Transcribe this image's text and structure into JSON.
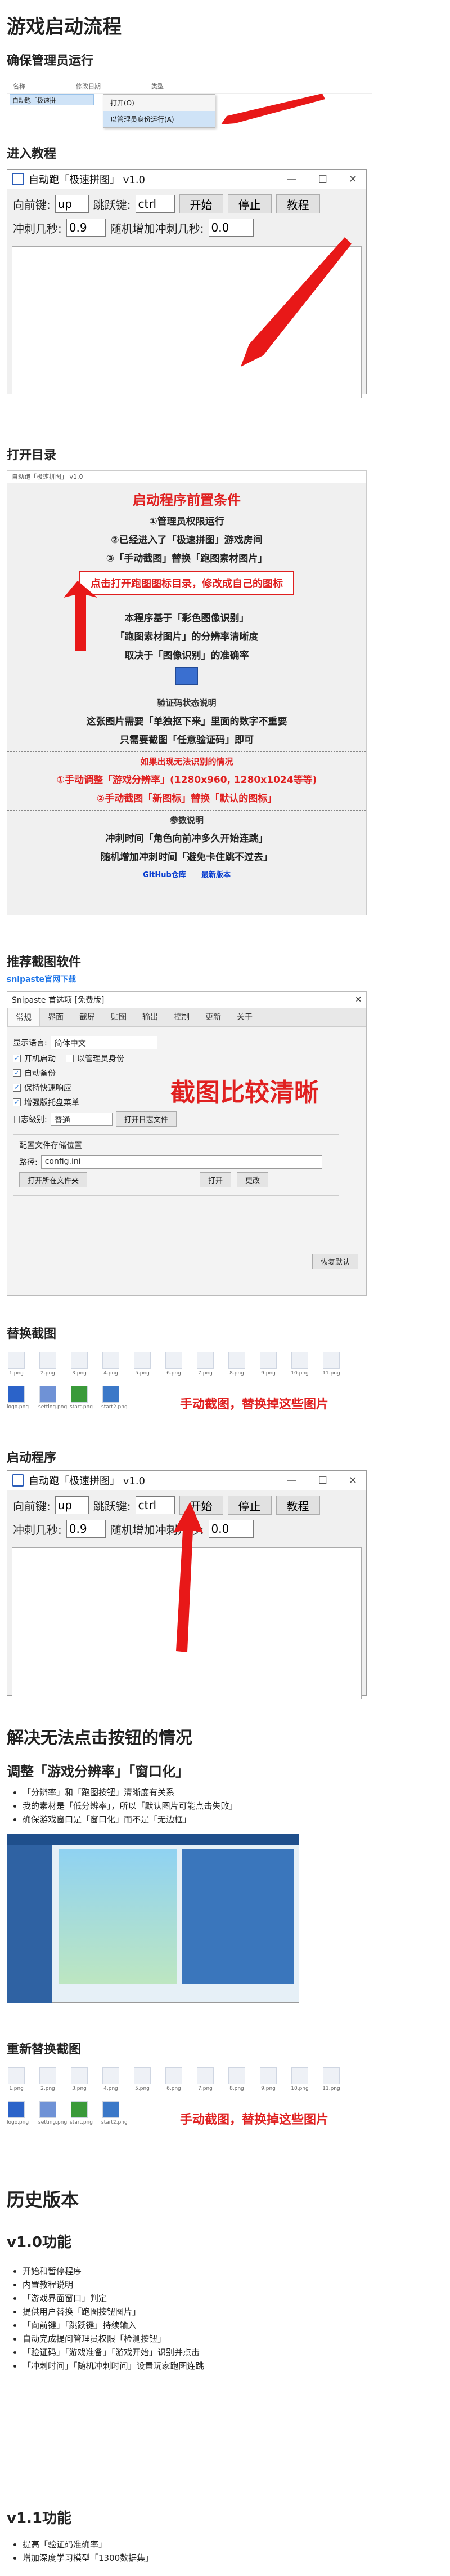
{
  "h_start_flow": "游戏启动流程",
  "h_admin": "确保管理员运行",
  "explorer": {
    "cols": [
      "名称",
      "修改日期",
      "类型"
    ],
    "row": "自动跑「极速拼",
    "menu": [
      "打开(O)",
      "以管理员身份运行(A)"
    ]
  },
  "h_tutorial": "进入教程",
  "app": {
    "title": "自动跑「极速拼图」 v1.0",
    "forward_label": "向前键:",
    "forward_val": "up",
    "jump_label": "跳跃键:",
    "jump_val": "ctrl",
    "start": "开始",
    "stop": "停止",
    "tutorial": "教程",
    "dash_label": "冲刺几秒:",
    "dash_val": "0.9",
    "rand_label": "随机增加冲刺几秒:",
    "rand_val": "0.0"
  },
  "h_open_dir": "打开目录",
  "guide": {
    "title": "自动跑「极速拼图」 v1.0",
    "head": "启动程序前置条件",
    "l1": "①管理员权限运行",
    "l2": "②已经进入了「极速拼图」游戏房间",
    "l3": "③「手动截图」替换「跑图素材图片」",
    "open_btn": "点击打开跑图图标目录，修改成自己的图标",
    "s1": "本程序基于「彩色图像识别」",
    "s2": "「跑图素材图片」的分辨率清晰度",
    "s3": "取决于「图像识别」的准确率",
    "sep1": "验证码状态说明",
    "v1": "这张图片需要「单独抠下来」里面的数字不重要",
    "v2": "只需要截图「任意验证码」即可",
    "sep2": "如果出现无法识别的情况",
    "r1": "①手动调整「游戏分辨率」(1280x960, 1280x1024等等)",
    "r2": "②手动截图「新图标」替换「默认的图标」",
    "sep3": "参数说明",
    "p1": "冲刺时间「角色向前冲多久开始连跳」",
    "p2": "随机增加冲刺时间「避免卡住跳不过去」",
    "footer_a": "GitHub仓库",
    "footer_b": "最新版本"
  },
  "h_recommend": "推荐截图软件",
  "snip_link": "snipaste官网下载",
  "snip": {
    "title": "Snipaste 首选项 [免费版]",
    "tabs": [
      "常规",
      "界面",
      "截屏",
      "贴图",
      "输出",
      "控制",
      "更新",
      "关于"
    ],
    "lang_label": "显示语言:",
    "lang_val": "简体中文",
    "opt1": "开机启动",
    "opt1b": "以管理员身份",
    "opt2": "自动备份",
    "opt3": "保持快速响应",
    "opt4": "增强版托盘菜单",
    "log_label": "日志级别:",
    "log_val": "普通",
    "log_btn": "打开日志文件",
    "cfg_group": "配置文件存储位置",
    "path_label": "路径:",
    "path_val": "config.ini",
    "open_folder": "打开所在文件夹",
    "open": "打开",
    "change": "更改",
    "restore": "恢复默认",
    "big_note": "截图比较清晰"
  },
  "h_replace": "替换截图",
  "icons_row1": [
    "1.png",
    "2.png",
    "3.png",
    "4.png",
    "5.png",
    "6.png",
    "7.png",
    "8.png",
    "9.png",
    "10.png",
    "11.png"
  ],
  "icons_row2": [
    "logo.png",
    "setting.png",
    "start.png",
    "start2.png"
  ],
  "replace_note": "手动截图，替换掉这些图片",
  "h_launch": "启动程序",
  "h_fix": "解决无法点击按钮的情况",
  "h_adjust": "调整「游戏分辨率」「窗口化」",
  "fix_items": [
    "「分辨率」和「跑图按钮」清晰度有关系",
    "我的素材是「低分辨率」，所以「默认图片可能点击失败」",
    "确保游戏窗口是「窗口化」而不是「无边框」"
  ],
  "h_rereplace": "重新替换截图",
  "h_history": "历史版本",
  "h_v10": "v1.0功能",
  "v10_items": [
    "开始和暂停程序",
    "内置教程说明",
    "「游戏界面窗口」判定",
    "提供用户替换「跑图按钮图片」",
    "「向前键」「跳跃键」持续输入",
    "自动完成提问管理员权限「检测按钮」",
    "「验证码」「游戏准备」「游戏开始」识别并点击",
    "「冲刺时间」「随机冲刺时间」设置玩家跑图连跳"
  ],
  "h_v11": "v1.1功能",
  "v11_items": [
    "提高「验证码准确率」",
    "增加深度学习模型「1300数据集」"
  ]
}
